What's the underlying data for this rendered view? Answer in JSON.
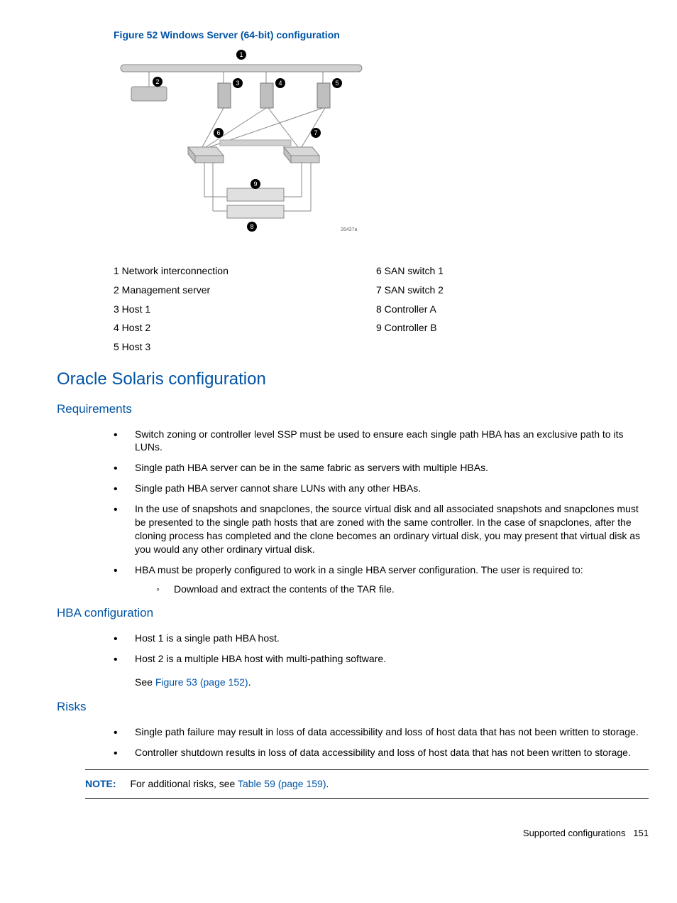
{
  "figure": {
    "caption": "Figure 52 Windows Server (64-bit) configuration",
    "id_label": "26437a"
  },
  "legend": {
    "left": [
      "1 Network interconnection",
      "2 Management server",
      "3 Host 1",
      "4 Host 2",
      "5 Host 3"
    ],
    "right": [
      "6 SAN switch 1",
      "7 SAN switch 2",
      "8 Controller A",
      "9 Controller B"
    ]
  },
  "section_title": "Oracle Solaris configuration",
  "requirements": {
    "title": "Requirements",
    "items": [
      "Switch zoning or controller level SSP must be used to ensure each single path HBA has an exclusive path to its LUNs.",
      "Single path HBA server can be in the same fabric as servers with multiple HBAs.",
      "Single path HBA server cannot share LUNs with any other HBAs.",
      "In the use of snapshots and snapclones, the source virtual disk and all associated snapshots and snapclones must be presented to the single path hosts that are zoned with the same controller. In the case of snapclones, after the cloning process has completed and the clone becomes an ordinary virtual disk, you may present that virtual disk as you would any other ordinary virtual disk.",
      "HBA must be properly configured to work in a single HBA server configuration. The user is required to:"
    ],
    "sub_items": [
      "Download and extract the contents of the TAR file."
    ]
  },
  "hba": {
    "title": "HBA configuration",
    "items": [
      "Host 1 is a single path HBA host.",
      "Host 2 is a multiple HBA host with multi-pathing software."
    ],
    "see_prefix": "See ",
    "see_link": "Figure 53 (page 152)",
    "see_suffix": "."
  },
  "risks": {
    "title": "Risks",
    "items": [
      "Single path failure may result in loss of data accessibility and loss of host data that has not been written to storage.",
      "Controller shutdown results in loss of data accessibility and loss of host data that has not been written to storage."
    ]
  },
  "note": {
    "label": "NOTE:",
    "text_prefix": "For additional risks, see ",
    "link": "Table 59 (page 159)",
    "text_suffix": "."
  },
  "footer": {
    "text": "Supported configurations",
    "page": "151"
  }
}
